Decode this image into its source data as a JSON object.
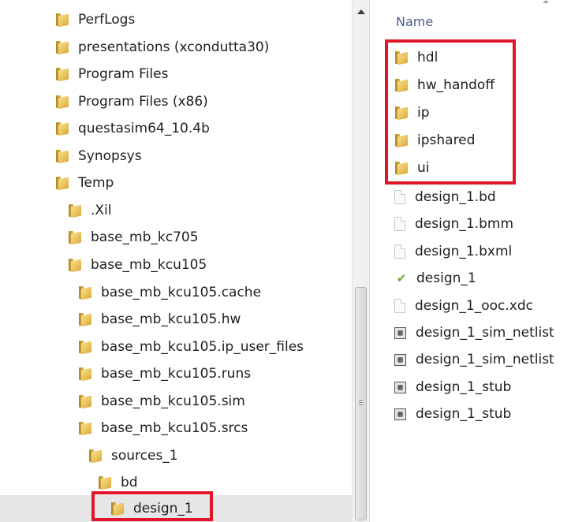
{
  "navigation": {
    "tree_items": [
      {
        "label": "PerfLogs"
      },
      {
        "label": "presentations (xcondutta30)"
      },
      {
        "label": "Program Files"
      },
      {
        "label": "Program Files (x86)"
      },
      {
        "label": "questasim64_10.4b"
      },
      {
        "label": "Synopsys"
      },
      {
        "label": "Temp"
      },
      {
        "label": ".Xil"
      },
      {
        "label": "base_mb_kc705"
      },
      {
        "label": "base_mb_kcu105"
      },
      {
        "label": "base_mb_kcu105.cache"
      },
      {
        "label": "base_mb_kcu105.hw"
      },
      {
        "label": "base_mb_kcu105.ip_user_files"
      },
      {
        "label": "base_mb_kcu105.runs"
      },
      {
        "label": "base_mb_kcu105.sim"
      },
      {
        "label": "base_mb_kcu105.srcs"
      },
      {
        "label": "sources_1"
      },
      {
        "label": "bd"
      },
      {
        "label": "design_1",
        "selected": true
      }
    ]
  },
  "content": {
    "column_header": "Name",
    "items": [
      {
        "label": "hdl",
        "icon": "folder-icon"
      },
      {
        "label": "hw_handoff",
        "icon": "folder-icon"
      },
      {
        "label": "ip",
        "icon": "folder-icon"
      },
      {
        "label": "ipshared",
        "icon": "folder-icon"
      },
      {
        "label": "ui",
        "icon": "folder-icon"
      },
      {
        "label": "design_1.bd",
        "icon": "file-icon"
      },
      {
        "label": "design_1.bmm",
        "icon": "file-icon"
      },
      {
        "label": "design_1.bxml",
        "icon": "file-icon"
      },
      {
        "label": "design_1",
        "icon": "vivado-leaf-icon"
      },
      {
        "label": "design_1_ooc.xdc",
        "icon": "file-icon"
      },
      {
        "label": "design_1_sim_netlist",
        "icon": "netlist-icon"
      },
      {
        "label": "design_1_sim_netlist",
        "icon": "netlist-icon"
      },
      {
        "label": "design_1_stub",
        "icon": "netlist-icon"
      },
      {
        "label": "design_1_stub",
        "icon": "netlist-icon"
      }
    ]
  },
  "colors": {
    "highlight": "#e0162b",
    "header_text": "#4b5e83",
    "selection_bg": "#e6e6e6"
  }
}
